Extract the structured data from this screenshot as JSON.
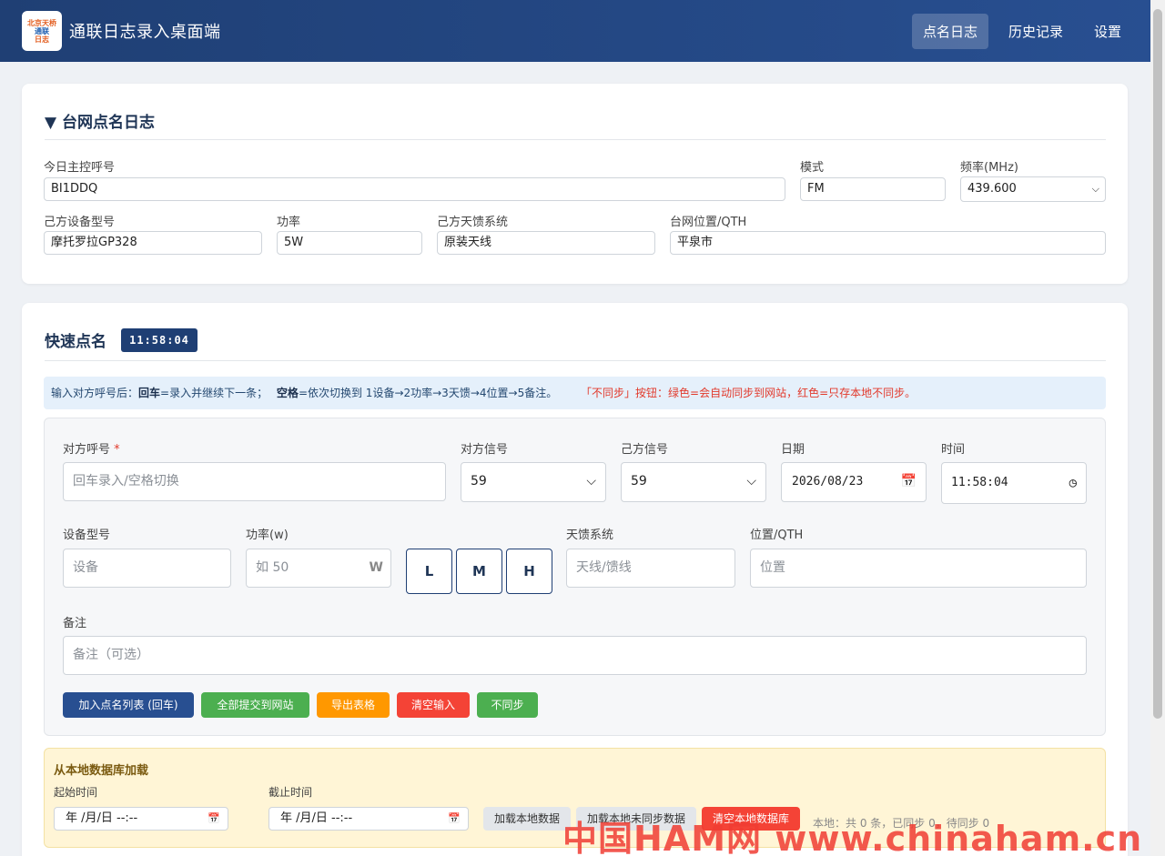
{
  "app": {
    "logo_lines": [
      "北京天桥",
      "通联",
      "日志"
    ],
    "title": "通联日志录入桌面端"
  },
  "nav": [
    "点名日志",
    "历史记录",
    "设置"
  ],
  "net_log": {
    "title": "▼ 台网点名日志",
    "host_label": "今日主控呼号",
    "host_value": "BI1DDQ",
    "mode_label": "模式",
    "mode_value": "FM",
    "freq_label": "频率(MHz)",
    "freq_value": "439.600",
    "device_label": "己方设备型号",
    "device_value": "摩托罗拉GP328",
    "power_label": "功率",
    "power_value": "5W",
    "antenna_label": "己方天馈系统",
    "antenna_value": "原装天线",
    "qth_label": "台网位置/QTH",
    "qth_value": "平泉市"
  },
  "quick": {
    "title": "快速点名",
    "clock": "11:58:04",
    "tip_prefix": "输入对方呼号后：",
    "tip_enter_key": "回车",
    "tip_enter_desc": "=录入并继续下一条；",
    "tip_space_key": "空格",
    "tip_space_desc": "=依次切换到 1设备→2功率→3天馈→4位置→5备注。",
    "tip_sync": "「不同步」按钮：绿色=会自动同步到网站，红色=只存本地不同步。",
    "callsign_label": "对方呼号",
    "required_mark": "*",
    "callsign_placeholder": "回车录入/空格切换",
    "their_signal_label": "对方信号",
    "their_signal_value": "59",
    "my_signal_label": "己方信号",
    "my_signal_value": "59",
    "date_label": "日期",
    "date_value": "2026/08/23",
    "time_label": "时间",
    "time_value": "11:58:04",
    "device_label": "设备型号",
    "device_placeholder": "设备",
    "power_label": "功率(w)",
    "power_placeholder": "如 50",
    "power_unit": "W",
    "power_presets": [
      "L",
      "M",
      "H"
    ],
    "antenna_label": "天馈系统",
    "antenna_placeholder": "天线/馈线",
    "qth_label": "位置/QTH",
    "qth_placeholder": "位置",
    "remark_label": "备注",
    "remark_placeholder": "备注（可选）",
    "buttons": {
      "add": "加入点名列表 (回车)",
      "submit_all": "全部提交到网站",
      "export": "导出表格",
      "clear": "清空输入",
      "no_sync": "不同步"
    }
  },
  "local_db": {
    "title": "从本地数据库加载",
    "start_label": "起始时间",
    "end_label": "截止时间",
    "datetime_placeholder": "年 /月/日 --:--",
    "load_btn": "加载本地数据",
    "load_unsynced_btn": "加载本地未同步数据",
    "clear_btn": "清空本地数据库",
    "stats": "本地：共 0 条，已同步 0，待同步 0"
  },
  "watermark": "中国HAM网 www.chinaham.cn"
}
